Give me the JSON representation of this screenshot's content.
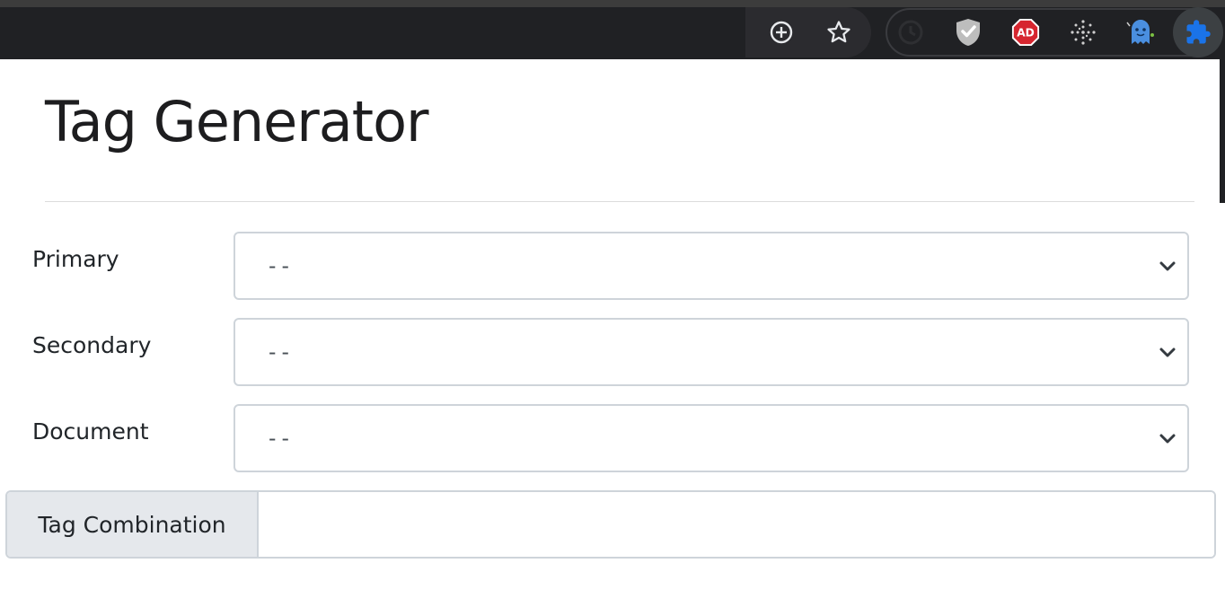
{
  "browser": {
    "toolbar_icons": [
      "zoom-plus-icon",
      "star-bookmark-icon"
    ],
    "extension_icons": [
      "history-clock-icon",
      "shield-check-icon",
      "adblock-icon",
      "sparkle-dots-icon",
      "ghost-icon",
      "puzzle-extensions-icon"
    ],
    "colors": {
      "toolbar_bg": "#202124",
      "adblock_red": "#d6262f",
      "ghost_blue": "#4a8fe0",
      "puzzle_blue": "#1a73e8"
    }
  },
  "page": {
    "title": "Tag Generator",
    "fields": [
      {
        "label": "Primary",
        "selected": "--"
      },
      {
        "label": "Secondary",
        "selected": "--"
      },
      {
        "label": "Document",
        "selected": "--"
      }
    ],
    "combination": {
      "label": "Tag Combination",
      "value": ""
    }
  }
}
